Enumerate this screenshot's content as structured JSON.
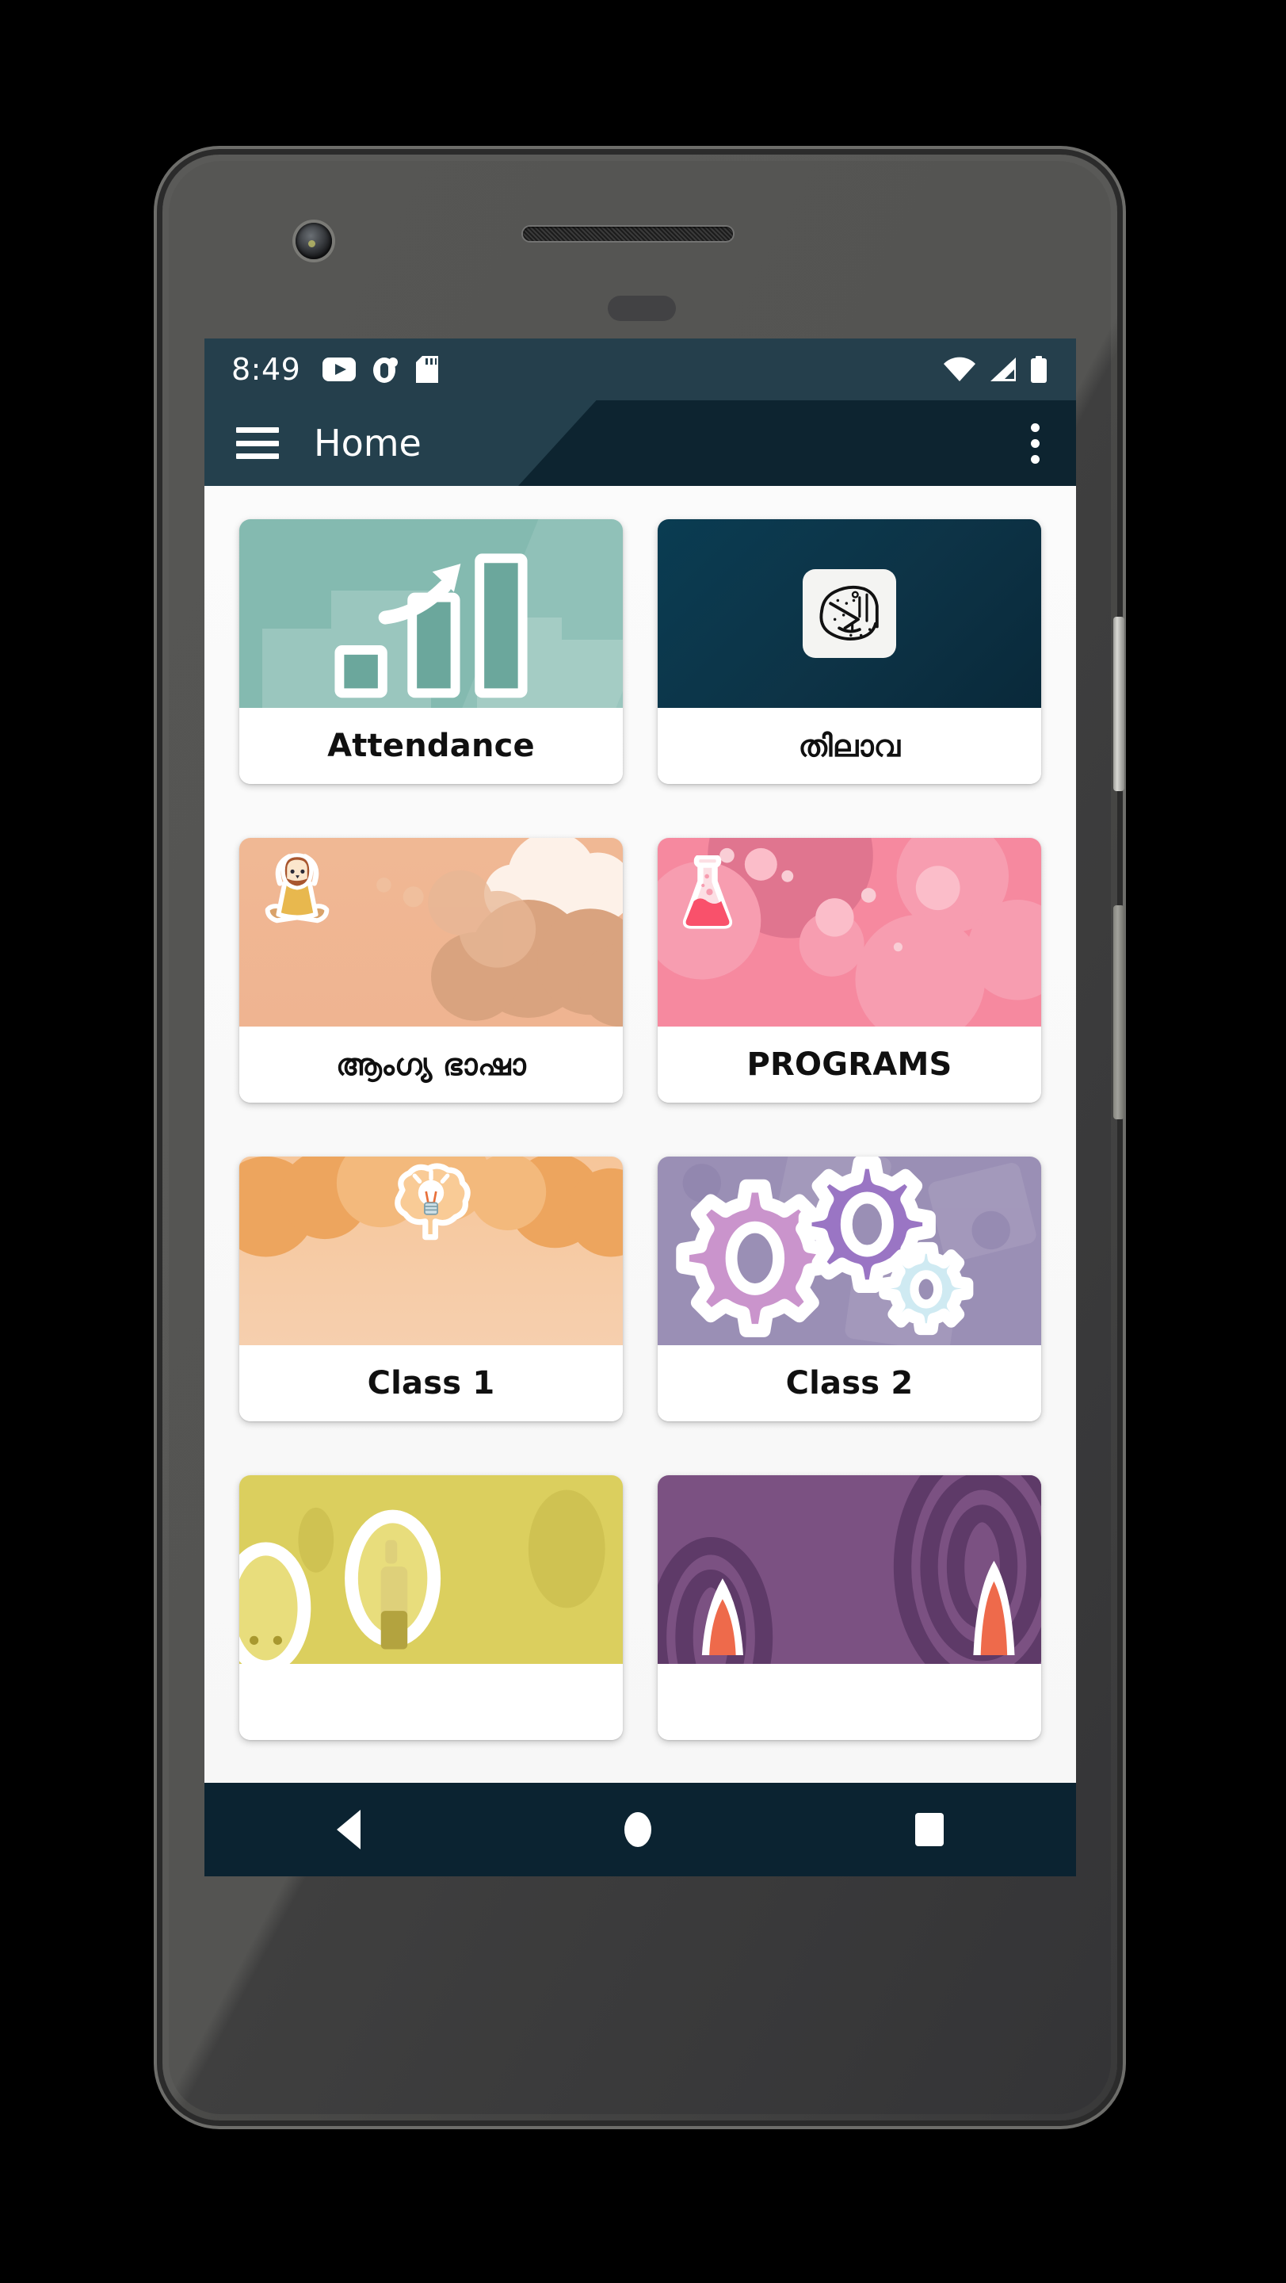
{
  "device": {
    "type": "android-phone-mockup",
    "hardware": {
      "earpiece": "speaker-grille",
      "front_camera": "front-camera",
      "sensor": "proximity-sensor",
      "volume_button": "volume-rocker",
      "power_button": "power-button"
    }
  },
  "status_bar": {
    "clock": "8:49",
    "background": "#253f4c",
    "left_icons": [
      "youtube-icon",
      "app-notification-icon",
      "sd-card-icon"
    ],
    "right_icons": [
      "wifi-icon",
      "cellular-signal-icon",
      "battery-icon"
    ]
  },
  "app_bar": {
    "title": "Home",
    "menu_icon": "hamburger-menu-icon",
    "overflow_icon": "overflow-menu-icon",
    "background": "#24404d",
    "accent_background": "#0d2430"
  },
  "content": {
    "background": "#f8f8f8",
    "cards": [
      {
        "label": "Attendance",
        "art": "bar-chart-growth-icon",
        "color": "#84bab0",
        "art_class": "art-attendance"
      },
      {
        "label": "തിലാവ",
        "art": "quran-calligraphy-icon",
        "color": "#0b3649",
        "art_class": "art-quran"
      },
      {
        "label": "ആംഗ്യ ഭാഷാ",
        "art": "yoga-meditation-icon",
        "color": "#efb491",
        "art_class": "art-yoga"
      },
      {
        "label": "PROGRAMS",
        "art": "lab-flask-icon",
        "color": "#f6899f",
        "art_class": "art-programs"
      },
      {
        "label": "Class 1",
        "art": "brain-lightbulb-icon",
        "color": "#f6c69a",
        "art_class": "art-brain"
      },
      {
        "label": "Class 2",
        "art": "gears-icon",
        "color": "#9a8fb5",
        "art_class": "art-gears"
      },
      {
        "label": "",
        "art": "lightbulb-character-icon",
        "color": "#dbcf5e",
        "art_class": "art-yellow"
      },
      {
        "label": "",
        "art": "rocket-icon",
        "color": "#7b5182",
        "art_class": "art-purple"
      }
    ]
  },
  "nav_bar": {
    "background": "#0b2331",
    "buttons": [
      "back-button",
      "home-button",
      "recents-button"
    ]
  }
}
